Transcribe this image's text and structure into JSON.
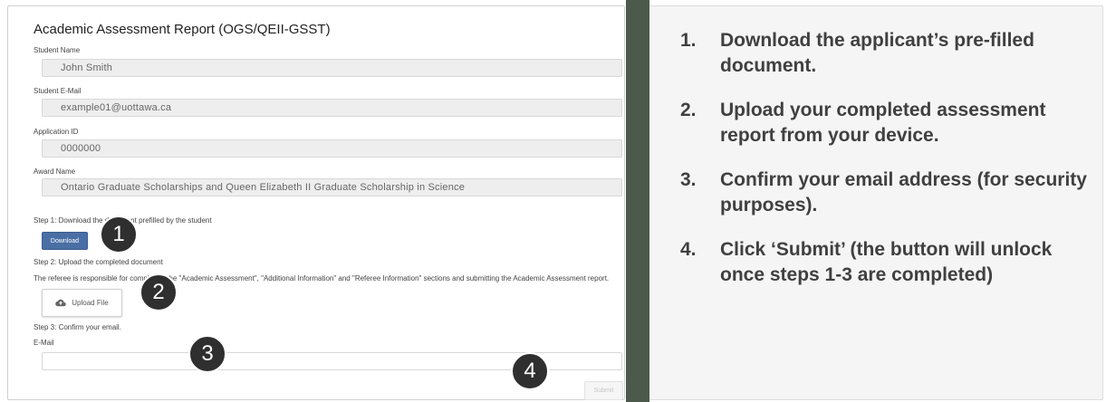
{
  "form": {
    "title": "Academic Assessment Report (OGS/QEII-GSST)",
    "student_name_label": "Student Name",
    "student_name_value": "John Smith",
    "student_email_label": "Student E-Mail",
    "student_email_value": "example01@uottawa.ca",
    "application_id_label": "Application ID",
    "application_id_value": "0000000",
    "award_name_label": "Award Name",
    "award_name_value": "Ontario Graduate Scholarships and Queen Elizabeth II Graduate Scholarship in Science",
    "step1_text": "Step 1: Download the document prefilled by the student",
    "download_label": "Download",
    "step2_text": "Step 2: Upload the completed document",
    "referee_note": "The referee is responsible for completing the \"Academic Assessment\", \"Additional Information\" and \"Referee Information\" sections and submitting the Academic Assessment report.",
    "upload_label": "Upload File",
    "step3_text": "Step 3: Confirm your email.",
    "email_label": "E-Mail",
    "email_value": "",
    "submit_label": "Submit"
  },
  "badges": [
    "1",
    "2",
    "3",
    "4"
  ],
  "instructions": [
    {
      "num": "1.",
      "text": "Download the applicant’s pre-filled document."
    },
    {
      "num": "2.",
      "text": "Upload your completed assessment report from your device."
    },
    {
      "num": "3.",
      "text": "Confirm your email address (for security purposes)."
    },
    {
      "num": "4.",
      "text": "Click ‘Submit’ (the button will unlock once steps 1-3 are completed)"
    }
  ],
  "colors": {
    "divider": "#4b5a4a",
    "download_button": "#4a6fa5",
    "badge": "#2f2f2f",
    "instruction_bg": "#f5f5f5"
  },
  "icons": {
    "upload": "cloud-upload-icon"
  }
}
